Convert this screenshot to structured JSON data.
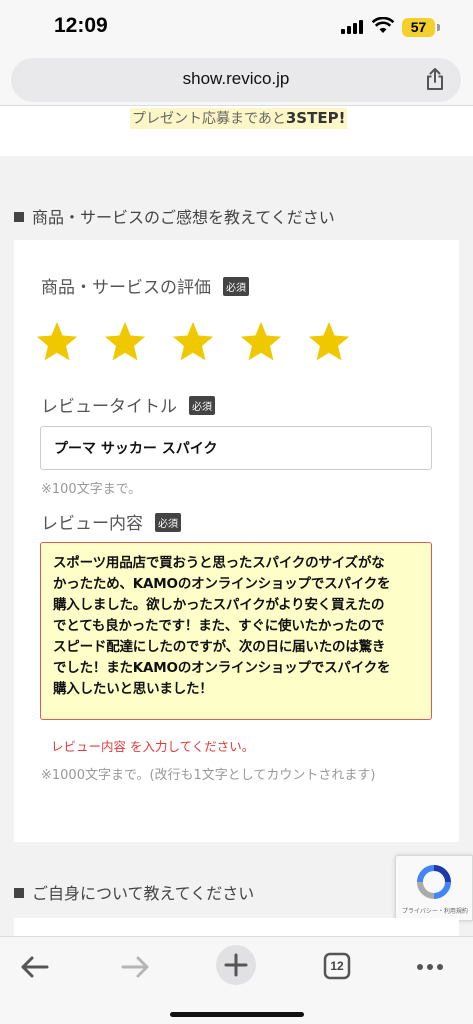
{
  "status": {
    "time": "12:09",
    "battery": "57"
  },
  "browser": {
    "url": "show.revico.jp",
    "tab_count": "12"
  },
  "promo": {
    "text": "プレゼント応募まであと",
    "highlight": "3STEP!"
  },
  "section1": {
    "title": "商品・サービスのご感想を教えてください"
  },
  "form": {
    "rating": {
      "label": "商品・サービスの評価",
      "required": "必須",
      "value": 5,
      "max": 5
    },
    "title": {
      "label": "レビュータイトル",
      "required": "必須",
      "value": "プーマ サッカー スパイク",
      "hint": "※100文字まで。"
    },
    "content": {
      "label": "レビュー内容",
      "required": "必須",
      "lines": [
        "スポーツ用品店で買おうと思ったスパイクのサイズがな",
        "かったため、KAMOのオンラインショップでスパイクを",
        "購入しました。欲しかったスパイクがより安く買えたの",
        "でとても良かったです！また、すぐに使いたかったので",
        "スピード配達にしたのですが、次の日に届いたのは驚き",
        "でした！またKAMOのオンラインショップでスパイクを",
        "購入したいと思いました！"
      ],
      "error": "レビュー内容 を入力してください。",
      "hint": "※1000文字まで。(改行も1文字としてカウントされます)"
    }
  },
  "section2": {
    "title": "ご自身について教えてください"
  },
  "recaptcha": {
    "text": "プライバシー・利用規約"
  },
  "colors": {
    "star": "#f0c800",
    "error": "#e03a3a",
    "textarea_bg": "#fefec8"
  }
}
